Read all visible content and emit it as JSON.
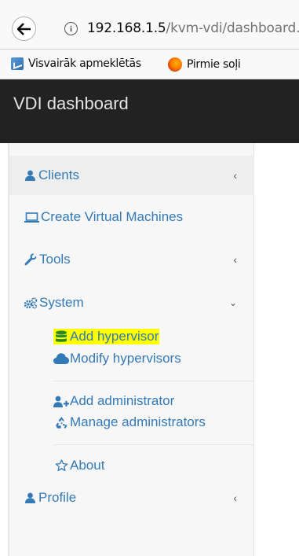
{
  "browser": {
    "url_host": "192.168.1.5",
    "url_path": "/kvm-vdi/dashboard."
  },
  "bookmarks": [
    {
      "label": "Visvairāk apmeklētās",
      "icon": "most-visited-icon"
    },
    {
      "label": "Pirmie soļi",
      "icon": "firefox-icon"
    }
  ],
  "app": {
    "title": "VDI dashboard"
  },
  "sidebar": {
    "items": [
      {
        "label": "Clients",
        "icon": "user-icon",
        "expandable": true,
        "active": true
      },
      {
        "label": "Create Virtual Machines",
        "icon": "laptop-icon",
        "expandable": false
      },
      {
        "label": "Tools",
        "icon": "wrench-icon",
        "expandable": true
      },
      {
        "label": "System",
        "icon": "cogs-icon",
        "expandable": true,
        "expanded": true
      },
      {
        "label": "Profile",
        "icon": "user-icon",
        "expandable": true
      }
    ],
    "system_submenu": [
      {
        "label": "Add hypervisor",
        "icon": "database-icon",
        "highlighted": true
      },
      {
        "label": "Modify hypervisors",
        "icon": "cloud-icon"
      },
      {
        "label": "Add administrator",
        "icon": "user-plus-icon"
      },
      {
        "label": "Manage administrators",
        "icon": "recycle-icon"
      },
      {
        "label": "About",
        "icon": "star-icon"
      }
    ]
  },
  "colors": {
    "link": "#337ab7",
    "header_bg": "#222222",
    "highlight": "#ffff00"
  }
}
